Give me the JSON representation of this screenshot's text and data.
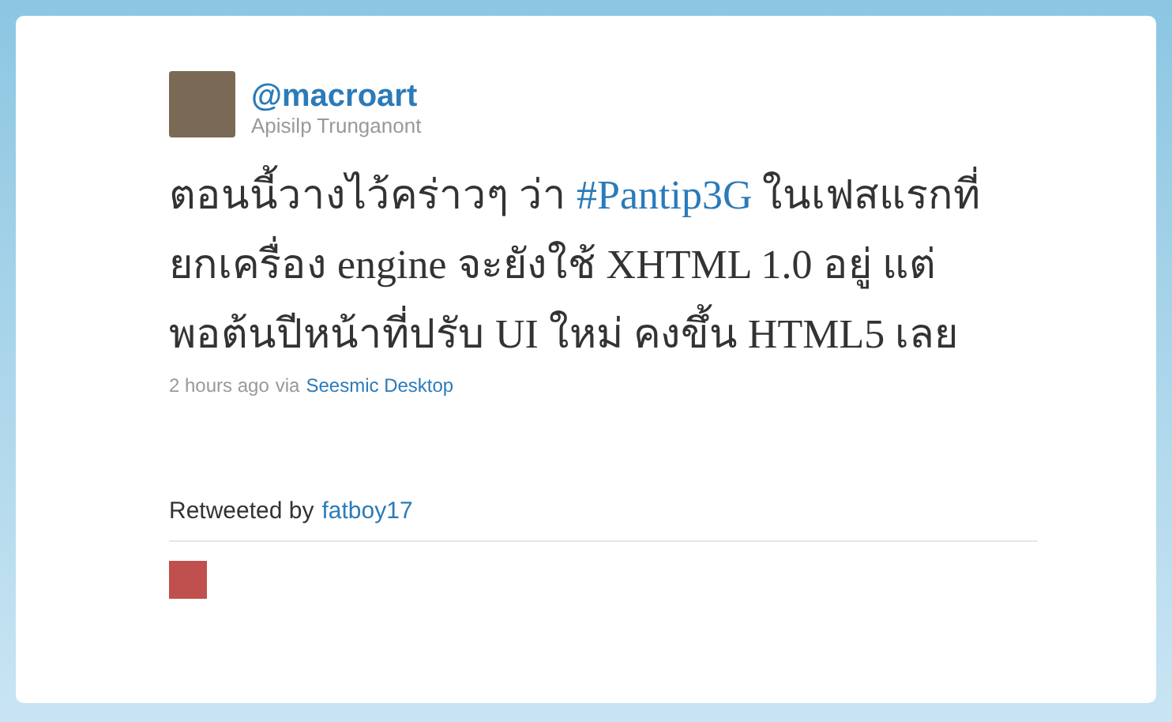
{
  "author": {
    "username": "@macroart",
    "full_name": "Apisilp Trunganont"
  },
  "tweet": {
    "lines": [
      [
        {
          "kind": "text",
          "text": "ตอนนี้วางไว้คร่าวๆ ว่า "
        },
        {
          "kind": "hashtag",
          "text": "#Pantip3G"
        },
        {
          "kind": "text",
          "text": " ในเฟสแรกที่"
        }
      ],
      [
        {
          "kind": "text",
          "text": "ยกเครื่อง engine จะยังใช้ XHTML 1.0 อยู่ แต่"
        }
      ],
      [
        {
          "kind": "text",
          "text": "พอต้นปีหน้าที่ปรับ UI ใหม่ คงขึ้น HTML5 เลย"
        }
      ]
    ]
  },
  "meta": {
    "time": "2 hours ago",
    "via": "via",
    "source": "Seesmic Desktop"
  },
  "retweet": {
    "label": "Retweeted by",
    "user": "fatboy17"
  }
}
